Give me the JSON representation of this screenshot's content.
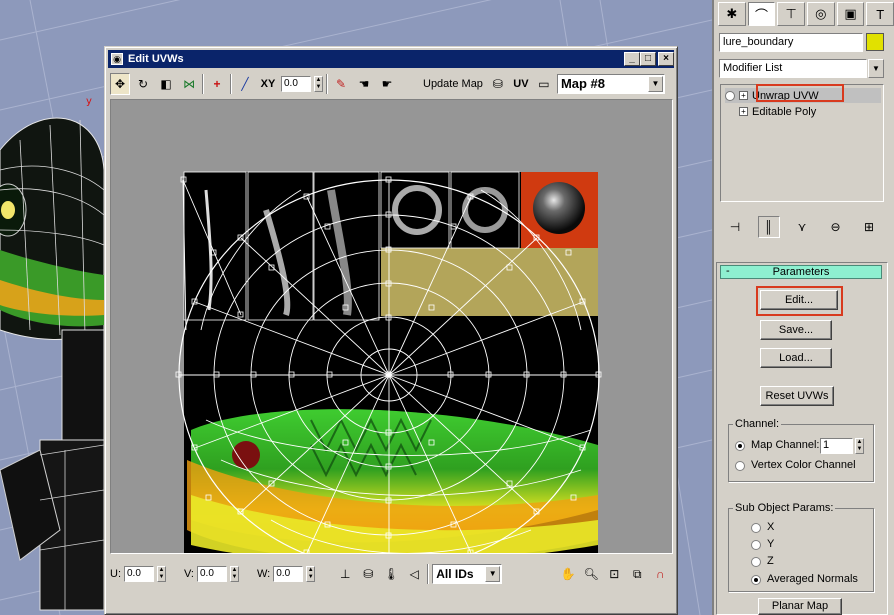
{
  "command_panel": {
    "tabs": [
      {
        "icon": "create-icon",
        "glyph": "✱"
      },
      {
        "icon": "modify-icon",
        "glyph": "⌒"
      },
      {
        "icon": "hierarchy-icon",
        "glyph": "⊤"
      },
      {
        "icon": "motion-icon",
        "glyph": "◎"
      },
      {
        "icon": "display-icon",
        "glyph": "▣"
      },
      {
        "icon": "utilities-icon",
        "glyph": "T"
      }
    ],
    "object_name": "lure_boundary",
    "object_color": "#e1e100",
    "modifier_list_label": "Modifier List",
    "stack": [
      {
        "label": "Unwrap UVW",
        "expander": "+",
        "selected": true
      },
      {
        "label": "Editable Poly",
        "expander": "+",
        "selected": false
      }
    ],
    "parameters_rollout": {
      "title": "Parameters",
      "collapse_glyph": "-",
      "edit_button": "Edit...",
      "save_button": "Save...",
      "load_button": "Load...",
      "reset_button": "Reset UVWs",
      "channel_group": "Channel:",
      "map_channel_label": "Map Channel:",
      "map_channel_value": "1",
      "vertex_color_label": "Vertex Color Channel",
      "subobject_group": "Sub Object Params:",
      "axis_x": "X",
      "axis_y": "Y",
      "axis_z": "Z",
      "averaged_normals": "Averaged Normals",
      "planar_map_button": "Planar Map"
    }
  },
  "edit_uvws": {
    "title": "Edit UVWs",
    "toolbar": {
      "xy_label": "XY",
      "value": "0.0",
      "update_map": "Update Map",
      "uv_label": "UV",
      "map_select": "Map #8"
    },
    "bottom": {
      "u_label": "U:",
      "v_label": "V:",
      "w_label": "W:",
      "u_value": "0.0",
      "v_value": "0.0",
      "w_value": "0.0",
      "ids_select": "All IDs"
    }
  }
}
